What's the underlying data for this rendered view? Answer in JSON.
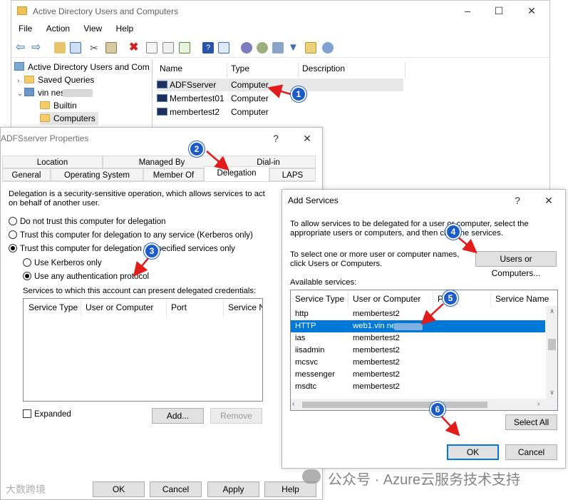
{
  "aduc": {
    "title": "Active Directory Users and Computers",
    "menu": [
      "File",
      "Action",
      "View",
      "Help"
    ],
    "tree": {
      "root": "Active Directory Users and Com",
      "saved_queries": "Saved Queries",
      "domain": "vin          nes.local",
      "builtin": "Builtin",
      "computers": "Computers"
    },
    "columns": [
      "Name",
      "Type",
      "Description"
    ],
    "rows": [
      {
        "name": "ADFSserver",
        "type": "Computer"
      },
      {
        "name": "Membertest01",
        "type": "Computer"
      },
      {
        "name": "membertest2",
        "type": "Computer"
      }
    ]
  },
  "props": {
    "title": "ADFSserver Properties",
    "help_glyph": "?",
    "close_glyph": "✕",
    "tabs_row1": [
      "Location",
      "Managed By",
      "Dial-in"
    ],
    "tabs_row2": [
      "General",
      "Operating System",
      "Member Of",
      "Delegation",
      "LAPS"
    ],
    "intro": "Delegation is a security-sensitive operation, which allows services to act on behalf of another user.",
    "opt_no_trust": "Do not trust this computer for delegation",
    "opt_any": "Trust this computer for delegation to any service (Kerberos only)",
    "opt_specified": "Trust this computer for delegation to specified services only",
    "opt_kerberos": "Use Kerberos only",
    "opt_any_auth": "Use any authentication protocol",
    "services_label": "Services to which this account can present delegated credentials:",
    "grid_cols": [
      "Service Type",
      "User or Computer",
      "Port",
      "Service N"
    ],
    "expanded": "Expanded",
    "add": "Add...",
    "remove": "Remove",
    "ok": "OK",
    "cancel": "Cancel",
    "apply": "Apply",
    "help": "Help"
  },
  "adds": {
    "title": "Add Services",
    "help_glyph": "?",
    "close_glyph": "✕",
    "intro": "To allow services to be delegated for a user or computer, select the appropriate users or computers, and then click the services.",
    "select_text": "To select one or more user or computer names, click Users or Computers.",
    "users_btn": "Users or Computers...",
    "available": "Available services:",
    "cols": [
      "Service Type",
      "User or Computer",
      "P",
      "Service Name"
    ],
    "rows": [
      {
        "type": "http",
        "user": "membertest2"
      },
      {
        "type": "HTTP",
        "user": "web1.vin          nes.cn"
      },
      {
        "type": "ias",
        "user": "membertest2"
      },
      {
        "type": "iisadmin",
        "user": "membertest2"
      },
      {
        "type": "mcsvc",
        "user": "membertest2"
      },
      {
        "type": "messenger",
        "user": "membertest2"
      },
      {
        "type": "msdtc",
        "user": "membertest2"
      }
    ],
    "select_all": "Select All",
    "ok": "OK",
    "cancel": "Cancel"
  },
  "badges": [
    "1",
    "2",
    "3",
    "4",
    "5",
    "6"
  ],
  "watermark": {
    "left": "大数跨境",
    "right": "公众号 · Azure云服务技术支持"
  },
  "colors": {
    "accent": "#0078d7",
    "badge": "#1d5cc8",
    "annotation_arrow": "#e21b1b"
  }
}
